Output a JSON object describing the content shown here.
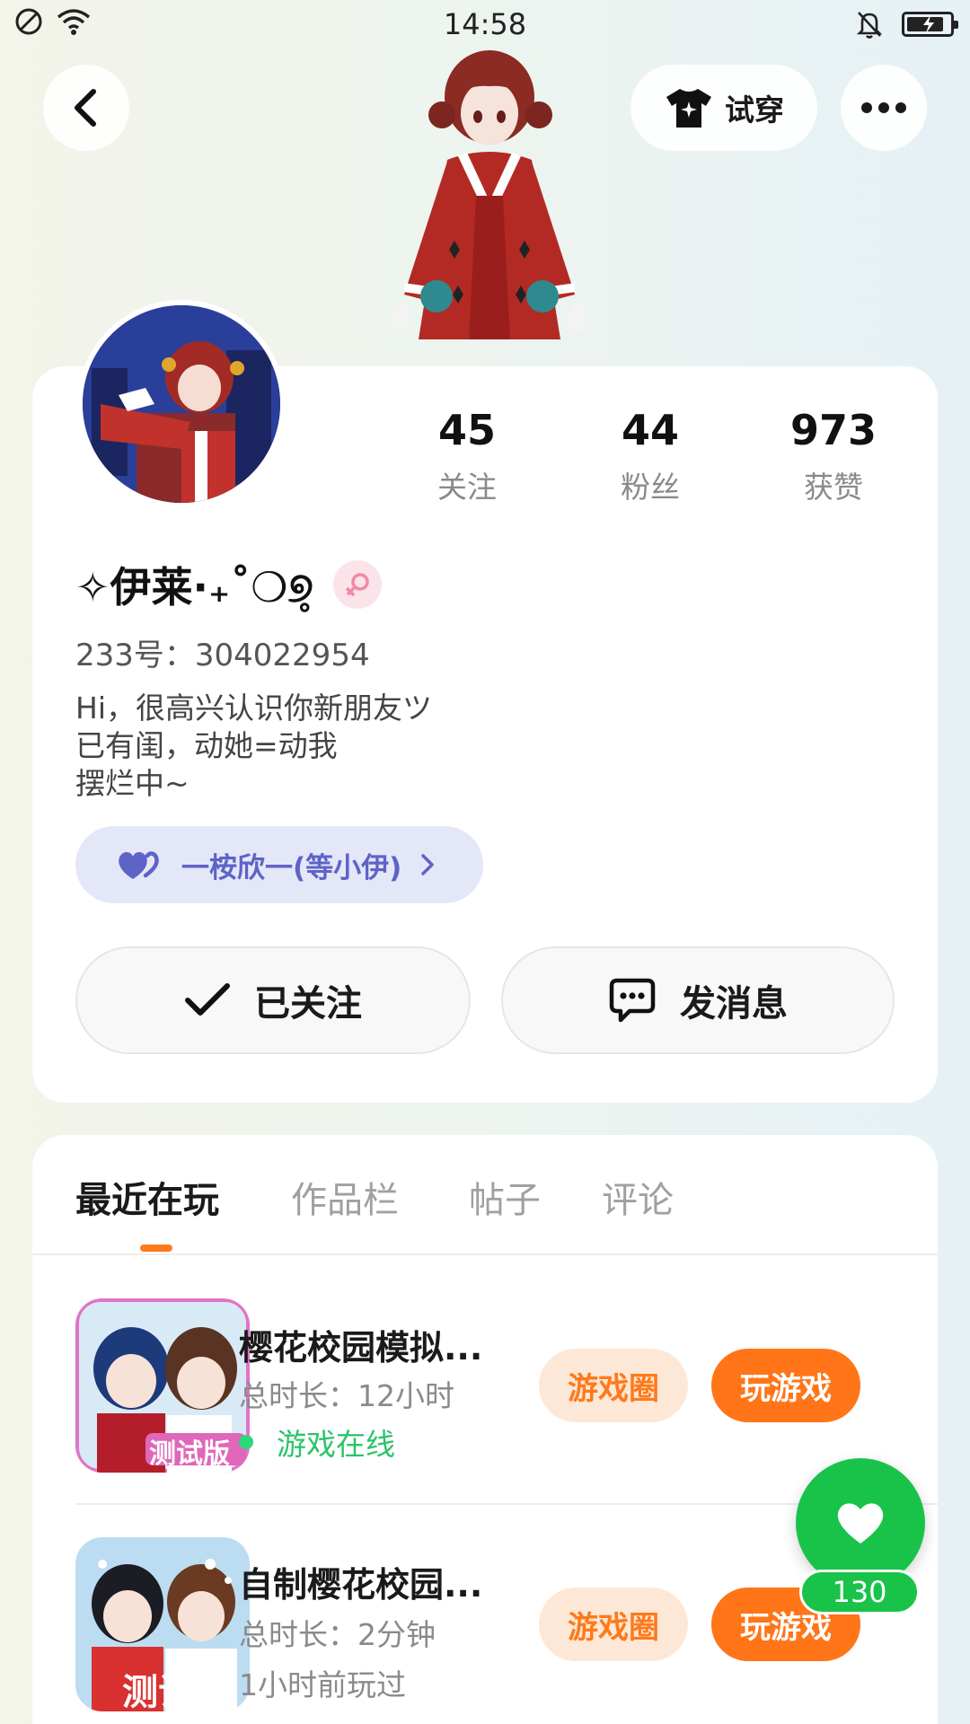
{
  "status_bar": {
    "time": "14:58",
    "icons": [
      "no-disturb-icon",
      "wifi-icon",
      "bell-off-icon",
      "battery-charging-icon"
    ]
  },
  "header": {
    "back_icon": "chevron-left-icon",
    "try_on_label": "试穿",
    "try_on_icon": "shirt-sparkle-icon",
    "more_icon": "more-dots-icon"
  },
  "profile": {
    "stats": [
      {
        "value": "45",
        "label": "关注"
      },
      {
        "value": "44",
        "label": "粉丝"
      },
      {
        "value": "973",
        "label": "获赞"
      }
    ],
    "nickname": "✧伊莱·₊˚❍୭̥",
    "gender_icon": "female-icon",
    "uid_text": "233号：304022954",
    "bio_lines": [
      "Hi，很高兴认识你新朋友ツ",
      "已有闺，动她=动我",
      "摆烂中~"
    ],
    "cp_label": "一桉欣一(等小伊)",
    "cp_icon": "double-heart-icon",
    "followed_label": "已关注",
    "message_label": "发消息"
  },
  "tabs": {
    "items": [
      "最近在玩",
      "作品栏",
      "帖子",
      "评论"
    ],
    "active_index": 0
  },
  "games": [
    {
      "title": "樱花校园模拟...",
      "duration": "总时长：12小时",
      "status": "游戏在线",
      "status_online": true,
      "circle_label": "游戏圈",
      "play_label": "玩游戏",
      "badge": "测试版"
    },
    {
      "title": "自制樱花校园...",
      "duration": "总时长：2分钟",
      "status": "1小时前玩过",
      "status_online": false,
      "circle_label": "游戏圈",
      "play_label": "玩游戏",
      "badge": "测试版"
    }
  ],
  "like_fab": {
    "count": "130",
    "icon": "heart-icon"
  },
  "colors": {
    "accent_orange": "#ff7518",
    "online_green": "#2cc36b",
    "fab_green": "#19c34a",
    "cp_purple": "#5e63c6"
  }
}
